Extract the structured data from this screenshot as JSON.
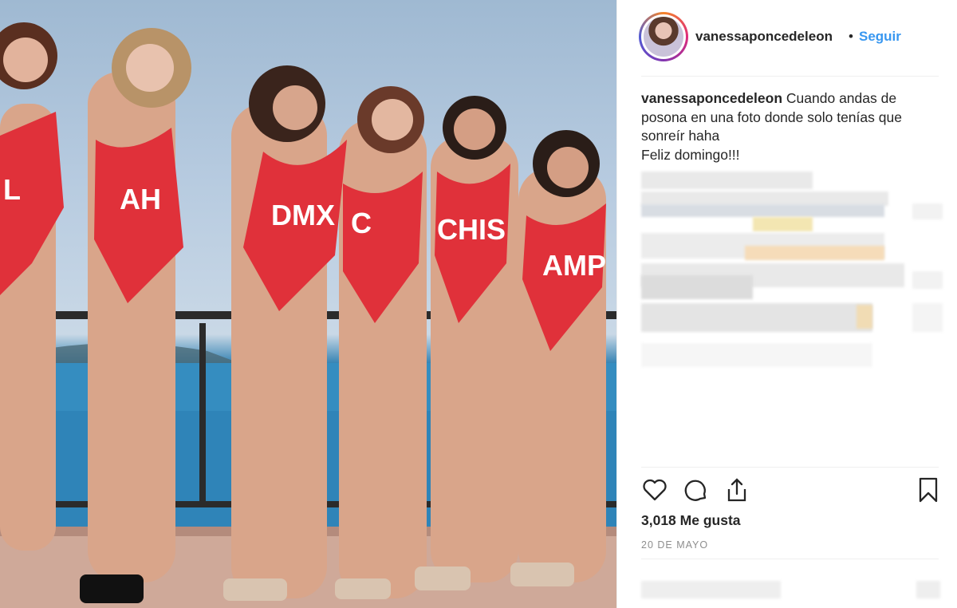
{
  "post": {
    "username": "vanessaponcedeleon",
    "separator": "•",
    "follow_label": "Seguir",
    "caption_user": "vanessaponcedeleon",
    "caption_lines": [
      "Cuando andas de",
      "posona en una foto donde solo tenías que",
      "sonreír haha"
    ],
    "caption_extra": "Feliz domingo!!!",
    "likes": "3,018 Me gusta",
    "date": "20 DE MAYO"
  },
  "photo": {
    "swimsuit_labels": [
      "L",
      "AH",
      "DMX",
      "C",
      "CHIS",
      "AMP"
    ],
    "swimsuit_color": "#e0313a"
  },
  "icons": [
    "heart-icon",
    "comment-icon",
    "share-icon",
    "bookmark-icon"
  ],
  "colors": {
    "accent": "#3897f0",
    "text": "#262626",
    "muted": "#8e8e8e",
    "border": "#efefef"
  }
}
